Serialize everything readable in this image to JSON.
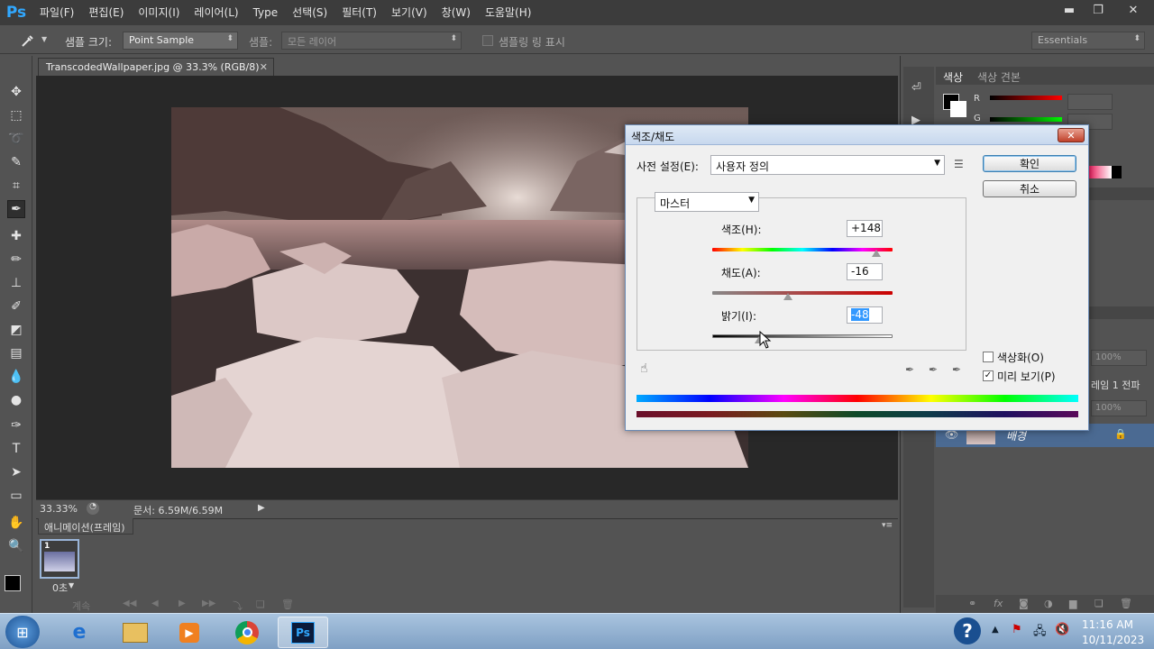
{
  "app": {
    "logo": "Ps",
    "menu": [
      "파일(F)",
      "편집(E)",
      "이미지(I)",
      "레이어(L)",
      "Type",
      "선택(S)",
      "필터(T)",
      "보기(V)",
      "창(W)",
      "도움말(H)"
    ],
    "window_controls": {
      "minimize": "▬",
      "restore": "❐",
      "close": "✕"
    }
  },
  "options_bar": {
    "sample_size_label": "샘플 크기:",
    "sample_size_value": "Point Sample",
    "sample_label": "샘플:",
    "sample_value": "모든 레이어",
    "show_ring_label": "샘플링 링 표시",
    "workspace": "Essentials"
  },
  "document": {
    "tab_title": "TranscodedWallpaper.jpg @ 33.3% (RGB/8)",
    "zoom": "33.33%",
    "doc_size": "문서: 6.59M/6.59M"
  },
  "animation": {
    "panel_title": "애니메이션(프레임)",
    "frame_number": "1",
    "frame_delay": "0초",
    "loop_label": "계속"
  },
  "right_panel": {
    "tab_color": "색상",
    "tab_swatches": "색상 견본",
    "r_label": "R",
    "g_label": "G",
    "opacity": "100%",
    "fill": "100%",
    "frame_propagate": "레임 1 전파",
    "layer_name": "배경"
  },
  "dialog": {
    "title": "색조/채도",
    "close_label": "✕",
    "preset_label": "사전 설정(E):",
    "preset_value": "사용자 정의",
    "ok_label": "확인",
    "cancel_label": "취소",
    "channel": "마스터",
    "hue_label": "색조(H):",
    "hue_value": "+148",
    "saturation_label": "채도(A):",
    "saturation_value": "-16",
    "lightness_label": "밝기(I):",
    "lightness_value": "-48",
    "colorize_label": "색상화(O)",
    "preview_label": "미리 보기(P)",
    "colorize_checked": false,
    "preview_checked": true,
    "hue_fraction": 0.91,
    "saturation_fraction": 0.42,
    "lightness_fraction": 0.26
  },
  "taskbar": {
    "time": "11:16 AM",
    "date": "10/11/2023",
    "ps_label": "Ps"
  }
}
